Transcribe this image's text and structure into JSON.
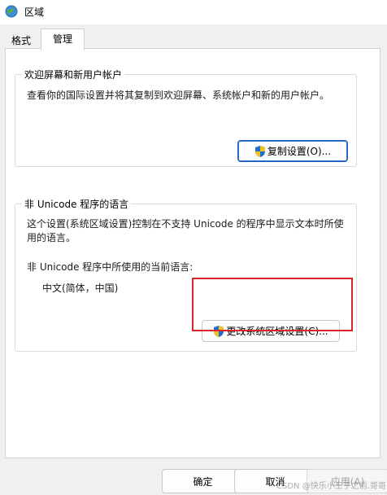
{
  "window": {
    "title": "区域"
  },
  "tabs": [
    {
      "label": "格式"
    },
    {
      "label": "管理"
    }
  ],
  "welcome_group": {
    "title": "欢迎屏幕和新用户帐户",
    "description": "查看你的国际设置并将其复制到欢迎屏幕、系统帐户和新的用户帐户。",
    "copy_button": "复制设置(O)..."
  },
  "unicode_group": {
    "title": "非 Unicode 程序的语言",
    "description_line1": "这个设置(系统区域设置)控制在不支持 Unicode 的程序中显示文本时所使",
    "description_line2": "用的语言。",
    "current_label": "非 Unicode 程序中所使用的当前语言:",
    "current_value": "中文(简体，中国)",
    "change_button": "更改系统区域设置(C)..."
  },
  "footer": {
    "ok": "确定",
    "cancel": "取消",
    "apply": "应用(A)"
  },
  "watermark": "CSDN @快乐小王子之前.哥哥",
  "colors": {
    "highlight": "#d8262d",
    "accent": "#0067c0"
  }
}
